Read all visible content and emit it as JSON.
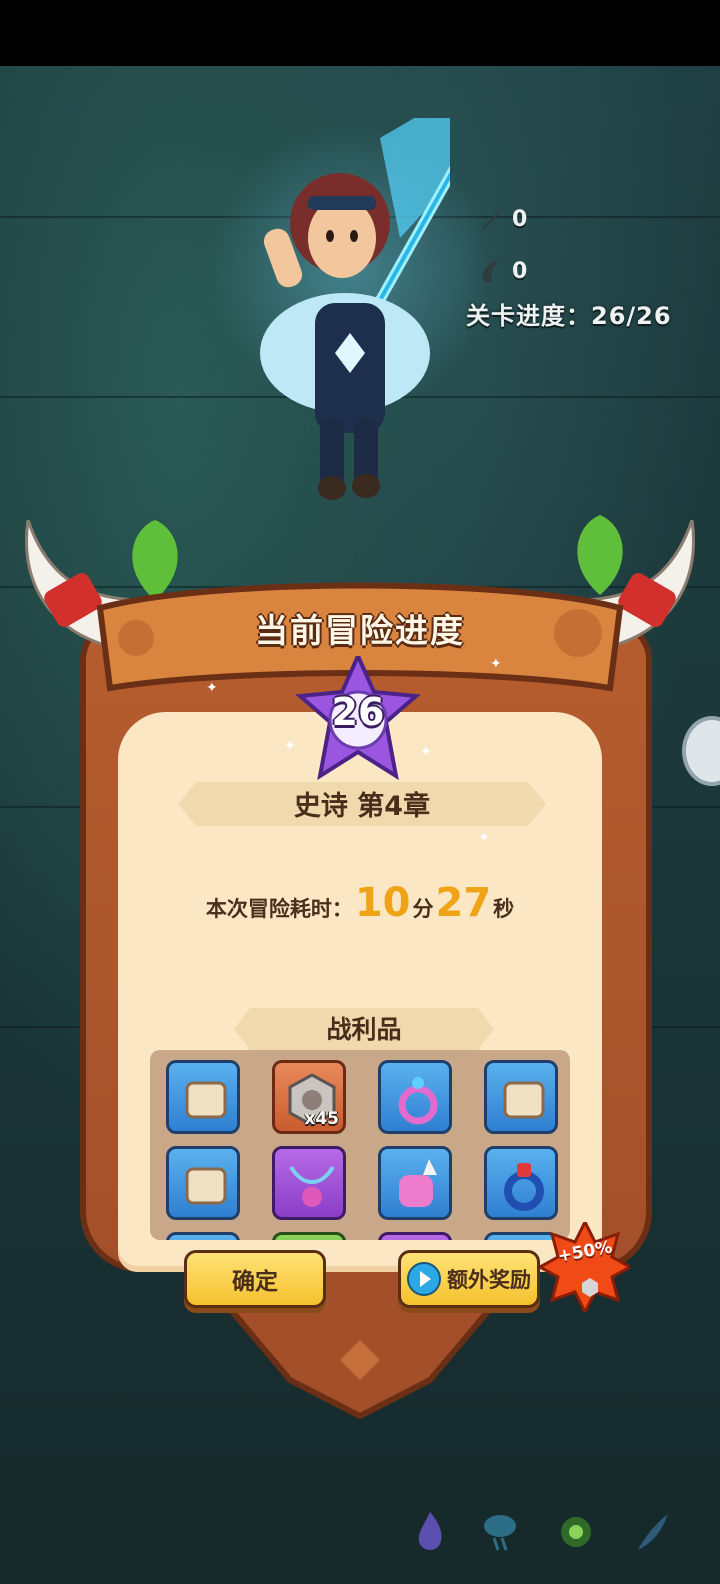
{
  "hud": {
    "kill_count": "0",
    "claw_count": "0",
    "stage_progress": "关卡进度：26/26"
  },
  "panel": {
    "title": "当前冒险进度",
    "stage_number": "26",
    "chapter": "史诗 第4章",
    "time": {
      "label": "本次冒险耗时：",
      "minutes": "10",
      "minutes_unit": "分",
      "seconds": "27",
      "seconds_unit": "秒"
    },
    "loot_title": "战利品",
    "loot": [
      {
        "icon": "scroll-icon",
        "rarity": "blue",
        "count": ""
      },
      {
        "icon": "hex-nut-icon",
        "rarity": "orange",
        "count": "x45"
      },
      {
        "icon": "pink-amulet-icon",
        "rarity": "blue",
        "count": ""
      },
      {
        "icon": "scroll-icon",
        "rarity": "blue",
        "count": ""
      },
      {
        "icon": "scroll-icon",
        "rarity": "blue",
        "count": ""
      },
      {
        "icon": "necklace-icon",
        "rarity": "purple",
        "count": ""
      },
      {
        "icon": "gauntlet-icon",
        "rarity": "blue",
        "count": ""
      },
      {
        "icon": "ring-icon",
        "rarity": "blue",
        "count": ""
      }
    ],
    "confirm_label": "确定",
    "extra_reward_label": "额外奖励",
    "bonus_badge": "+50%"
  },
  "colors": {
    "accent_gold": "#f0a316",
    "button_yellow": "#f5c12d",
    "board_orange": "#b65d2f",
    "parchment": "#fbe7c4"
  }
}
